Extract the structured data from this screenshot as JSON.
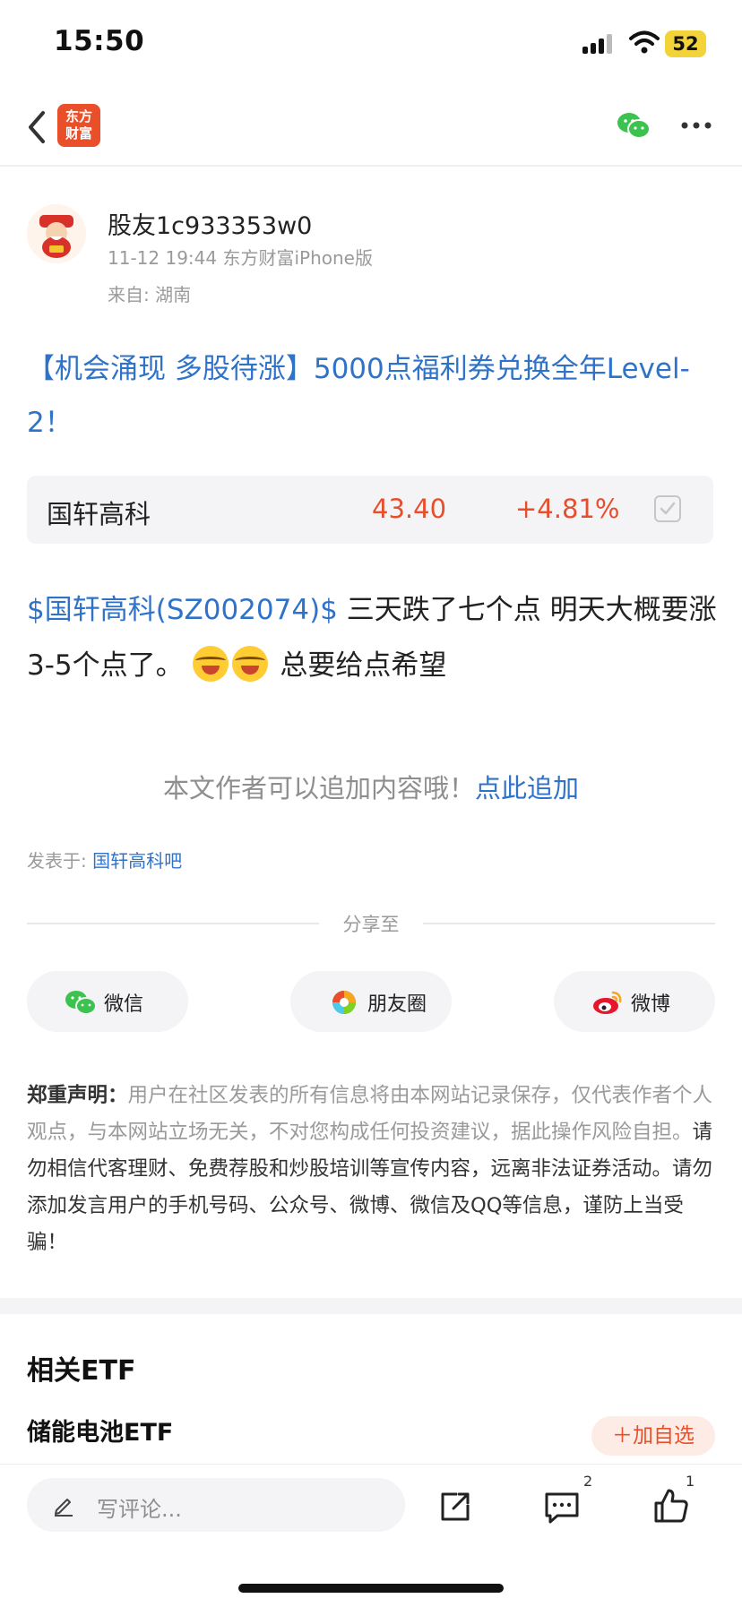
{
  "status_bar": {
    "time": "15:50",
    "battery": "52"
  },
  "nav": {
    "logo_line1": "东方",
    "logo_line2": "财富"
  },
  "author": {
    "name": "股友1c933353w0",
    "meta": "11-12 19:44 东方财富iPhone版",
    "from": "来自: 湖南"
  },
  "post": {
    "title": "【机会涌现 多股待涨】5000点福利券兑换全年Level-2！",
    "stock": {
      "name": "国轩高科",
      "price": "43.40",
      "change": "+4.81%"
    },
    "body_link": "$国轩高科(SZ002074)$",
    "body_text1": " 三天跌了七个点 明天大概要涨3-5个点了。",
    "body_text2": " 总要给点希望",
    "append_prompt": "本文作者可以追加内容哦！",
    "append_link": "点此追加",
    "posted_in_label": "发表于: ",
    "posted_in_link": "国轩高科吧"
  },
  "share": {
    "label": "分享至",
    "wechat": "微信",
    "moments": "朋友圈",
    "weibo": "微博"
  },
  "disclaimer": {
    "heading": "郑重声明：",
    "text_gray": "用户在社区发表的所有信息将由本网站记录保存，仅代表作者个人观点，与本网站立场无关，不对您构成任何投资建议，据此操作风险自担。",
    "text_dark": "请勿相信代客理财、免费荐股和炒股培训等宣传内容，远离非法证券活动。请勿添加发言用户的手机号码、公众号、微博、微信及QQ等信息，谨防上当受骗！"
  },
  "etf": {
    "header": "相关ETF",
    "name": "储能电池ETF",
    "add_button": "＋加自选"
  },
  "toolbar": {
    "comment_placeholder": "写评论...",
    "comment_count": "2",
    "like_count": "1"
  },
  "colors": {
    "brand": "#e9502a",
    "link": "#2f73c9",
    "up": "#e94e2c"
  }
}
